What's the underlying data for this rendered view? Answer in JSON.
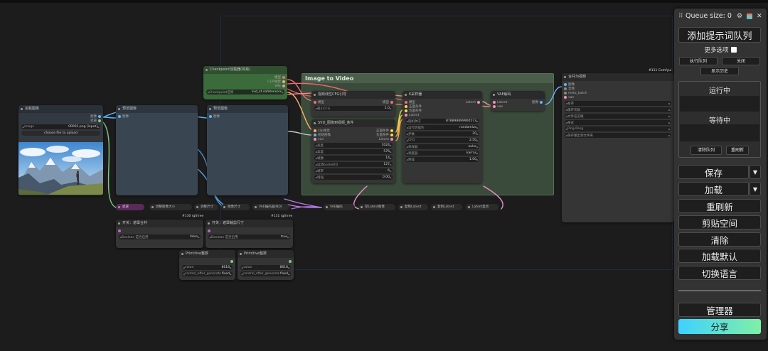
{
  "panel": {
    "queue_size": "Queue size: 0",
    "handle_glyph": "⠿",
    "gear_glyph": "⚙",
    "close_glyph": "✕",
    "add_prompt_queue": "添加提示词队列",
    "more_options": "更多选项",
    "execute_queue": "执行队列",
    "close": "关闭",
    "view_history": "显示历史",
    "running": "运行中",
    "pending": "等待中",
    "clear_queue": "清除队列",
    "refresh_queue": "重刷新",
    "save": "保存",
    "load": "加载",
    "dropdown_glyph": "▼",
    "refresh": "重刷新",
    "clipspace": "剪贴空间",
    "clear": "清除",
    "load_default": "加载默认",
    "switch_language": "切换语言",
    "manager": "管理器",
    "share": "分享",
    "share_gradient": [
      "#3fd1ff",
      "#7ff0a6"
    ]
  },
  "canvas": {
    "group_title": "Image to Video",
    "load_image": {
      "title": "加载图像",
      "image_label": "image",
      "image_value": "00001.png [input]",
      "upload": "choose file to upload",
      "outputs": [
        "图像",
        "遮罩"
      ]
    },
    "preview1": {
      "title": "预览图像",
      "input": "图像"
    },
    "preview2": {
      "title": "预览图像",
      "input": "图像"
    },
    "checkpoint": {
      "title": "Checkpoint加载器(简易)",
      "outputs": [
        "模型",
        "CLIP视觉",
        "VAE"
      ],
      "widget_label": "Checkpoint名称",
      "widget_value": "svd_xt.safetensors"
    },
    "cfg": {
      "title": "视频线性CFG引导",
      "input": "模型",
      "output": "模型",
      "widget_label": "最小CFG",
      "widget_value": "1.0"
    },
    "svd": {
      "title": "SVD_图像到视频_条件",
      "inputs": [
        "clip视觉",
        "初始图像",
        "vae"
      ],
      "outputs": [
        "正面条件",
        "负面条件",
        "Latent"
      ],
      "widgets": [
        {
          "label": "宽度",
          "value": "1024"
        },
        {
          "label": "高度",
          "value": "576"
        },
        {
          "label": "帧数",
          "value": "14"
        },
        {
          "label": "运动bucketID",
          "value": "127"
        },
        {
          "label": "帧率",
          "value": "6"
        },
        {
          "label": "增强",
          "value": "0.00"
        }
      ]
    },
    "ksampler": {
      "title": "K采样器",
      "inputs": [
        "模型",
        "正面条件",
        "负面条件",
        "Latent"
      ],
      "output": "Latent",
      "widgets": [
        {
          "label": "随机种子",
          "value": "878898899900573"
        },
        {
          "label": "运行后操作",
          "value": "randomize"
        },
        {
          "label": "步数",
          "value": "20"
        },
        {
          "label": "CFG",
          "value": "2.50"
        },
        {
          "label": "采样器",
          "value": "euler"
        },
        {
          "label": "调度器",
          "value": "karras"
        },
        {
          "label": "降噪",
          "value": "1.00"
        }
      ]
    },
    "vae_decode": {
      "title": "VAE解码",
      "inputs": [
        "Latent",
        "vae"
      ],
      "output": "图像"
    },
    "combine": {
      "title": "合并为视频",
      "badge": "#111 Comfyui",
      "inputs": [
        "图像",
        "音频",
        "meta_batch",
        "vae"
      ],
      "widgets": [
        "帧率",
        "循环次数",
        "文件名前缀",
        "格式",
        "Ping-Pong",
        "保存输出到文件夹"
      ]
    },
    "pills": [
      "遮罩",
      "调整图像大小",
      "调整尺寸",
      "图像尺寸",
      "VAE编码器(ND)",
      "VAE编码",
      "空Latent图像",
      "复制Latent",
      "复制Latent",
      "Latent复合"
    ],
    "rg_labels": [
      "#130 rgthree",
      "#131 rgthree"
    ],
    "switch1": {
      "title": "开关：遮罩合并",
      "label": "Boolean 是否启用",
      "value": "false"
    },
    "switch2": {
      "title": "开关：遮罩裁剪尺寸",
      "label": "Boolean 是否启用",
      "value": "true"
    },
    "prim1": {
      "title": "Primitive整数",
      "w1_label": "value",
      "w1_value": "8618",
      "w2_label": "control_after_generate",
      "w2_value": "fixed"
    },
    "prim2": {
      "title": "Primitive整数",
      "w1_label": "value",
      "w1_value": "8618",
      "w2_label": "control_after_generate",
      "w2_value": "fixed"
    }
  }
}
